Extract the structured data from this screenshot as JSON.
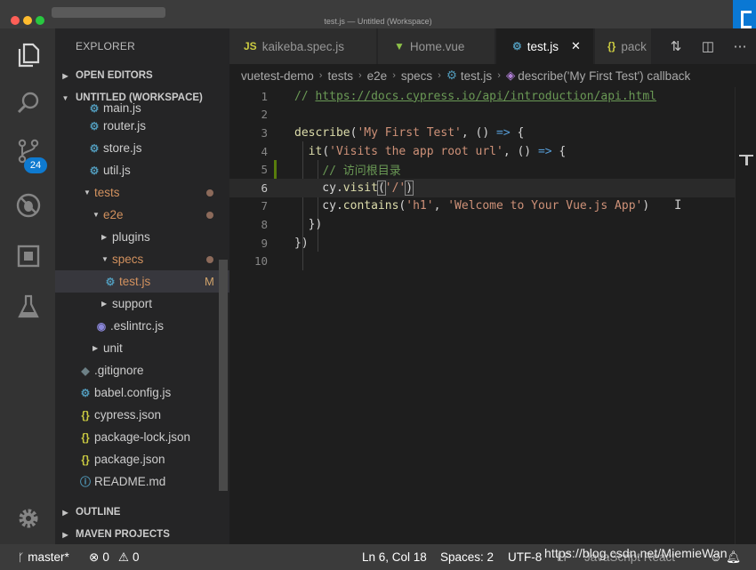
{
  "window": {
    "title": "test.js — Untitled (Workspace)"
  },
  "activity": {
    "scm_badge": "24"
  },
  "sidebar": {
    "title": "EXPLORER",
    "open_editors": "OPEN EDITORS",
    "workspace": "UNTITLED (WORKSPACE)",
    "outline": "OUTLINE",
    "maven": "MAVEN PROJECTS",
    "tree": [
      {
        "label": "main.js",
        "icon": "gear-icon"
      },
      {
        "label": "router.js",
        "icon": "gear-icon"
      },
      {
        "label": "store.js",
        "icon": "gear-icon"
      },
      {
        "label": "util.js",
        "icon": "gear-icon"
      },
      {
        "label": "tests",
        "icon": "folder"
      },
      {
        "label": "e2e",
        "icon": "folder"
      },
      {
        "label": "plugins",
        "icon": "folder"
      },
      {
        "label": "specs",
        "icon": "folder"
      },
      {
        "label": "test.js",
        "icon": "gear-icon",
        "status": "M"
      },
      {
        "label": "support",
        "icon": "folder"
      },
      {
        "label": ".eslintrc.js",
        "icon": "eslint-icon"
      },
      {
        "label": "unit",
        "icon": "folder"
      },
      {
        "label": ".gitignore",
        "icon": "git-icon"
      },
      {
        "label": "babel.config.js",
        "icon": "gear-icon"
      },
      {
        "label": "cypress.json",
        "icon": "json-icon"
      },
      {
        "label": "package-lock.json",
        "icon": "json-icon"
      },
      {
        "label": "package.json",
        "icon": "json-icon"
      },
      {
        "label": "README.md",
        "icon": "info-icon"
      }
    ]
  },
  "tabs": [
    {
      "label": "kaikeba.spec.js",
      "icon": "JS"
    },
    {
      "label": "Home.vue",
      "icon": "V"
    },
    {
      "label": "test.js",
      "icon": "gear",
      "active": true
    },
    {
      "label": "pack",
      "icon": "{}"
    }
  ],
  "breadcrumb": [
    "vuetest-demo",
    "tests",
    "e2e",
    "specs",
    "test.js",
    "describe('My First Test') callback"
  ],
  "editor": {
    "lines": [
      {
        "n": "1",
        "text": "// https://docs.cypress.io/api/introduction/api.html"
      },
      {
        "n": "2",
        "text": ""
      },
      {
        "n": "3",
        "text": "describe('My First Test', () => {"
      },
      {
        "n": "4",
        "text": "  it('Visits the app root url', () => {"
      },
      {
        "n": "5",
        "text": "    // 访问根目录"
      },
      {
        "n": "6",
        "text": "    cy.visit('/')"
      },
      {
        "n": "7",
        "text": "    cy.contains('h1', 'Welcome to Your Vue.js App')"
      },
      {
        "n": "8",
        "text": "  })"
      },
      {
        "n": "9",
        "text": "})"
      },
      {
        "n": "10",
        "text": ""
      }
    ],
    "current_line": 6
  },
  "status": {
    "branch": "master*",
    "errors": "0",
    "warnings": "0",
    "position": "Ln 6, Col 18",
    "spaces": "Spaces: 2",
    "encoding": "UTF-8",
    "eol": "LF",
    "language": "JavaScript React"
  },
  "watermark": "https://blog.csdn.net/MiemieWan",
  "colors": {
    "accent": "#0e7ad0",
    "background": "#1e1e1e",
    "sidebar": "#252526"
  }
}
